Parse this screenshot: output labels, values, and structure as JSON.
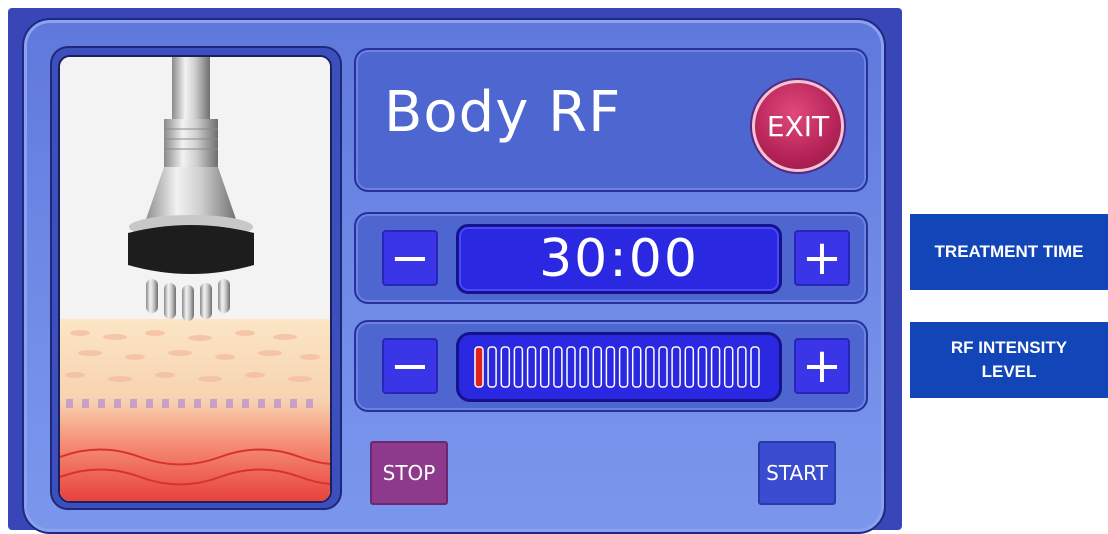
{
  "title": "Body RF",
  "exit_label": "EXIT",
  "treatment_time": {
    "minus_label": "−",
    "value": "30:00",
    "plus_label": "+"
  },
  "rf_intensity": {
    "minus_label": "−",
    "plus_label": "+",
    "level": 1,
    "max_level": 22
  },
  "stop_label": "STOP",
  "start_label": "START",
  "side_labels": {
    "treatment_time": "TREATMENT TIME",
    "rf_intensity": "RF INTENSITY LEVEL"
  },
  "colors": {
    "accent_blue": "#2a28e0",
    "exit_red": "#b52357",
    "stop_purple": "#8e3a8c",
    "label_blue": "#1245b8",
    "active_bar": "#e0221c"
  },
  "icons": [
    "minus-icon",
    "plus-icon",
    "rf-handpiece-illustration"
  ]
}
